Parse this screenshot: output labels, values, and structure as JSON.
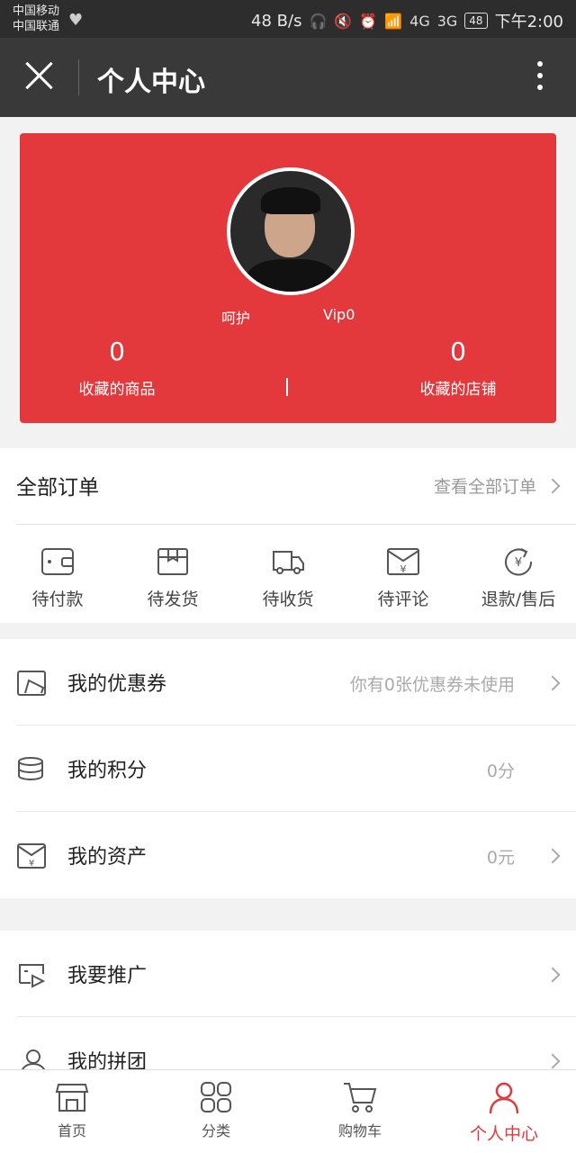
{
  "status_bar": {
    "carrier1": "中国移动",
    "carrier2": "中国联通",
    "net_speed": "48 B/s",
    "signal1": "4G",
    "signal2": "3G",
    "battery": "48",
    "time": "下午2:00"
  },
  "title_bar": {
    "title": "个人中心"
  },
  "profile": {
    "username": "呵护",
    "vip": "Vip0",
    "fav_goods_count": "0",
    "fav_goods_label": "收藏的商品",
    "fav_shops_count": "0",
    "fav_shops_label": "收藏的店铺",
    "bg_color": "#e4393c"
  },
  "orders": {
    "title": "全部订单",
    "view_all": "查看全部订单",
    "statuses": [
      {
        "label": "待付款",
        "icon": "wallet-icon"
      },
      {
        "label": "待发货",
        "icon": "package-icon"
      },
      {
        "label": "待收货",
        "icon": "truck-icon"
      },
      {
        "label": "待评论",
        "icon": "envelope-yen-icon"
      },
      {
        "label": "退款/售后",
        "icon": "refund-icon"
      }
    ]
  },
  "menu1": [
    {
      "label": "我的优惠券",
      "value": "你有0张优惠券未使用",
      "icon": "coupon-icon"
    },
    {
      "label": "我的积分",
      "value": "0分",
      "icon": "coins-icon"
    },
    {
      "label": "我的资产",
      "value": "0元",
      "icon": "asset-icon"
    }
  ],
  "menu2": [
    {
      "label": "我要推广",
      "icon": "promote-icon"
    },
    {
      "label": "我的拼团",
      "icon": "group-icon"
    }
  ],
  "tabbar": [
    {
      "label": "首页",
      "icon": "store-icon"
    },
    {
      "label": "分类",
      "icon": "grid-icon"
    },
    {
      "label": "购物车",
      "icon": "cart-icon"
    },
    {
      "label": "个人中心",
      "icon": "user-icon",
      "active": true
    }
  ],
  "accent_color": "#e4393c"
}
